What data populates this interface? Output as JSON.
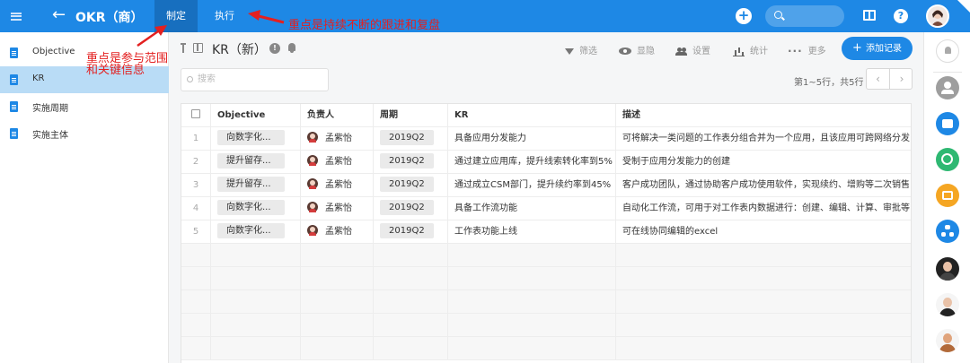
{
  "app": {
    "title": "OKR（商）",
    "back_icon": "arrow-left-icon",
    "menu_icon": "hamburger-menu-icon"
  },
  "tabs": [
    {
      "label": "制定",
      "active": true
    },
    {
      "label": "执行",
      "active": false
    }
  ],
  "annotations": {
    "top": "重点是持续不断的跟进和复盘",
    "side_line1": "重点是参与范围",
    "side_line2": "和关键信息",
    "color": "#e32020"
  },
  "sidebar": {
    "items": [
      {
        "label": "Objective",
        "active": false,
        "icon": "document-icon"
      },
      {
        "label": "KR",
        "active": true,
        "icon": "document-icon"
      },
      {
        "label": "实施周期",
        "active": false,
        "icon": "document-icon"
      },
      {
        "label": "实施主体",
        "active": false,
        "icon": "document-icon"
      }
    ]
  },
  "view": {
    "title": "KR（新）",
    "search_placeholder": "搜索",
    "page_info": "第1~5行，共5行",
    "toolbar": {
      "filter": "筛选",
      "show_hide": "显隐",
      "settings": "设置",
      "stats": "统计",
      "more": "更多",
      "add_record": "添加记录"
    }
  },
  "table": {
    "columns": [
      "Objective",
      "负责人",
      "周期",
      "KR",
      "描述"
    ],
    "rows": [
      {
        "no": "1",
        "objective": "向数字化...",
        "owner": "孟紫怡",
        "period": "2019Q2",
        "kr": "具备应用分发能力",
        "desc": "可将解决一类问题的工作表分组合并为一个应用，且该应用可跨网络分发"
      },
      {
        "no": "2",
        "objective": "提升留存...",
        "owner": "孟紫怡",
        "period": "2019Q2",
        "kr": "通过建立应用库，提升线索转化率到5%",
        "desc": "受制于应用分发能力的创建"
      },
      {
        "no": "3",
        "objective": "提升留存...",
        "owner": "孟紫怡",
        "period": "2019Q2",
        "kr": "通过成立CSM部门，提升续约率到45%",
        "desc": "客户成功团队，通过协助客户成功使用软件，实现续约、增购等二次销售"
      },
      {
        "no": "4",
        "objective": "向数字化...",
        "owner": "孟紫怡",
        "period": "2019Q2",
        "kr": "具备工作流功能",
        "desc": "自动化工作流，可用于对工作表内数据进行：创建、编辑、计算、审批等"
      },
      {
        "no": "5",
        "objective": "向数字化...",
        "owner": "孟紫怡",
        "period": "2019Q2",
        "kr": "工作表功能上线",
        "desc": "可在线协同编辑的excel"
      }
    ]
  },
  "colors": {
    "primary": "#1e88e5",
    "sidebar_active": "#b9dcf6",
    "green": "#2eb872",
    "orange": "#f5a623"
  }
}
